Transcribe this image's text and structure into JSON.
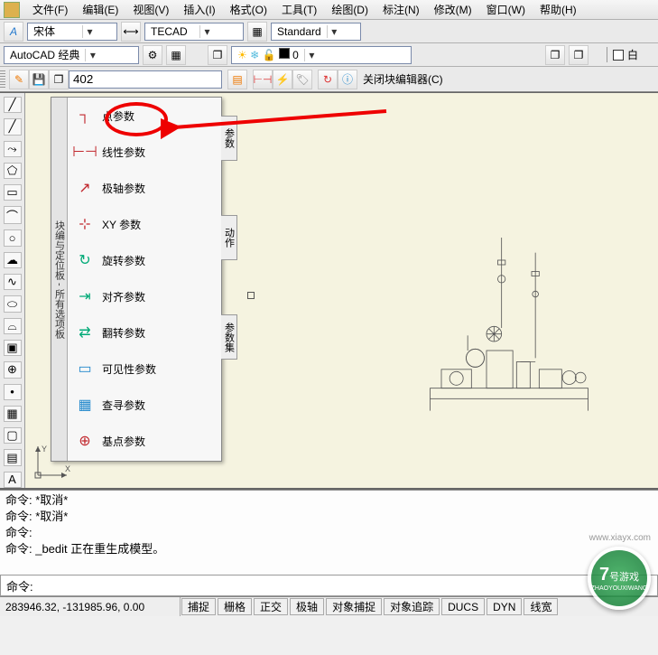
{
  "menu": {
    "items": [
      "文件(F)",
      "编辑(E)",
      "视图(V)",
      "插入(I)",
      "格式(O)",
      "工具(T)",
      "绘图(D)",
      "标注(N)",
      "修改(M)",
      "窗口(W)",
      "帮助(H)"
    ]
  },
  "stylebar": {
    "font_letter": "A",
    "font_name": "宋体",
    "dim_style": "TECAD",
    "table_style": "Standard"
  },
  "layerbar": {
    "workspace": "AutoCAD 经典",
    "layer_swatch": "■",
    "layer_name": "0",
    "color_label": "白"
  },
  "editorbar": {
    "block_name": "402",
    "close_label": "关闭块编辑器(C)"
  },
  "palette": {
    "title": "块编与定位板 - 所有选项板",
    "items": [
      {
        "label": "点参数",
        "icon_color": "#c1272d"
      },
      {
        "label": "线性参数",
        "icon_color": "#c1272d"
      },
      {
        "label": "极轴参数",
        "icon_color": "#c1272d"
      },
      {
        "label": "XY 参数",
        "icon_color": "#c1272d"
      },
      {
        "label": "旋转参数",
        "icon_color": "#0a7"
      },
      {
        "label": "对齐参数",
        "icon_color": "#0a7"
      },
      {
        "label": "翻转参数",
        "icon_color": "#0a7"
      },
      {
        "label": "可见性参数",
        "icon_color": "#28c"
      },
      {
        "label": "查寻参数",
        "icon_color": "#28c"
      },
      {
        "label": "基点参数",
        "icon_color": "#c1272d"
      }
    ],
    "tabs": [
      "参数",
      "动作",
      "参数集"
    ]
  },
  "command": {
    "lines": [
      "命令: *取消*",
      "命令: *取消*",
      "命令:",
      "命令: _bedit 正在重生成模型。"
    ],
    "prompt": "命令:"
  },
  "status": {
    "coords": "283946.32, -131985.96, 0.00",
    "buttons": [
      "捕捉",
      "栅格",
      "正交",
      "极轴",
      "对象捕捉",
      "对象追踪",
      "DUCS",
      "DYN",
      "线宽"
    ]
  },
  "watermark": {
    "url": "www.xiayx.com",
    "num": "7",
    "name": "号游戏",
    "py": "ZHAOYOUXIWANG"
  }
}
